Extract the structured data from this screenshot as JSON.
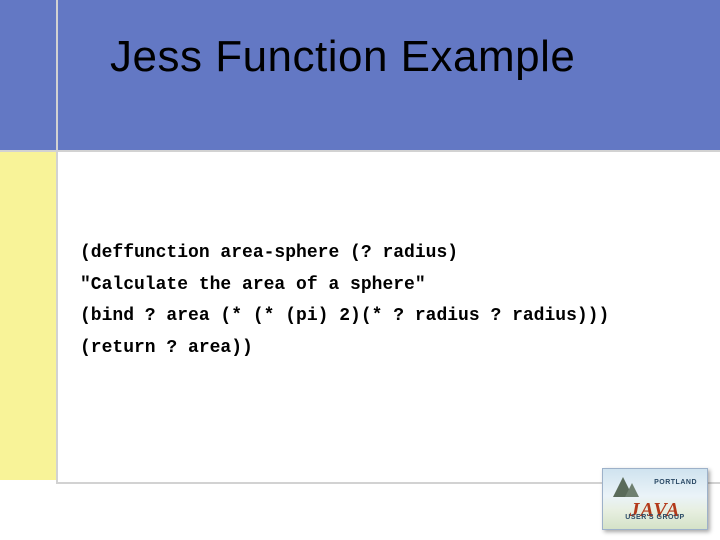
{
  "slide": {
    "title": "Jess Function Example",
    "code": {
      "line1": "(deffunction area-sphere (? radius)",
      "line2": "\"Calculate the area of a sphere\"",
      "line3": "(bind ? area (* (* (pi) 2)(* ? radius ? radius)))",
      "line4": "(return ? area))"
    }
  },
  "logo": {
    "top_label": "PORTLAND",
    "main": "JAVA",
    "bottom_label": "USER'S GROUP"
  }
}
